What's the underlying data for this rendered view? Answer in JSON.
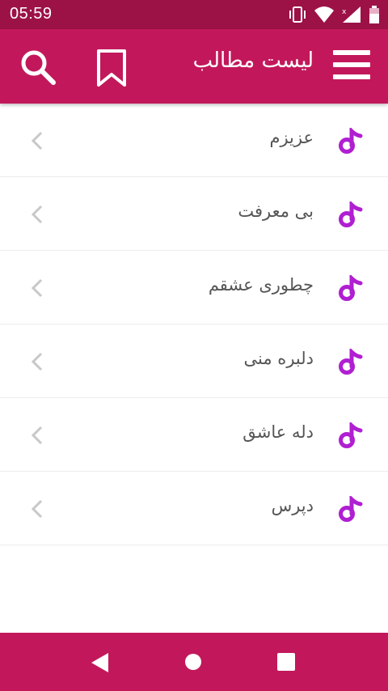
{
  "status": {
    "time": "05:59"
  },
  "appbar": {
    "title": "لیست مطالب"
  },
  "items": [
    {
      "label": "عزیزم"
    },
    {
      "label": "بی معرفت"
    },
    {
      "label": "چطوری عشقم"
    },
    {
      "label": "دلبره منی"
    },
    {
      "label": "دله عاشق"
    },
    {
      "label": "دپرس"
    }
  ],
  "colors": {
    "primary": "#c2185b",
    "status_bar": "#9c1247",
    "note_icon": "#b01fd1",
    "chevron": "#c8c8c8"
  },
  "icons": [
    "menu-icon",
    "bookmark-icon",
    "search-icon",
    "music-note-icon",
    "chevron-left-icon",
    "back-icon",
    "home-icon",
    "recents-icon"
  ]
}
